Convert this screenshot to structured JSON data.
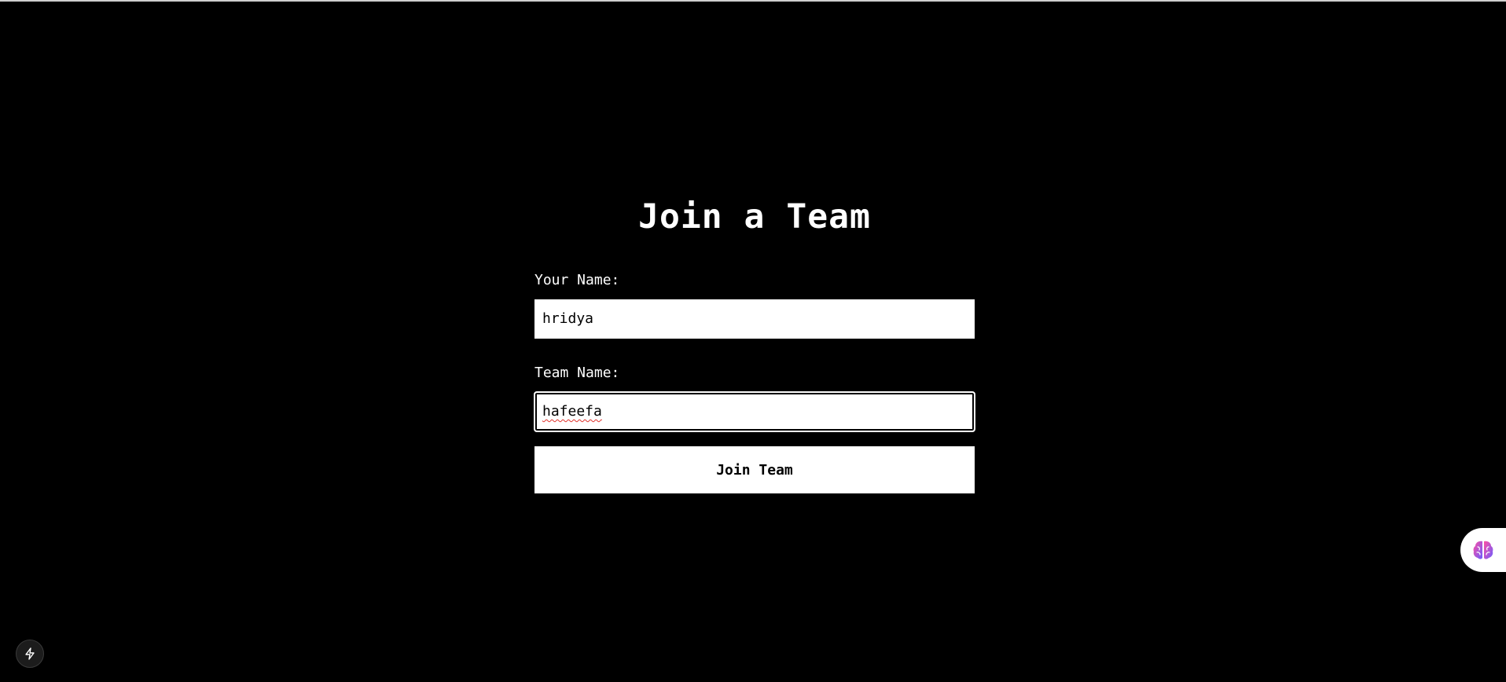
{
  "page": {
    "title": "Join a Team"
  },
  "form": {
    "name_label": "Your Name:",
    "name_value": "hridya",
    "team_label": "Team Name:",
    "team_value": "hafeefa",
    "submit_label": "Join Team"
  },
  "widgets": {
    "brain_icon": "brain-icon",
    "bolt_icon": "lightning-bolt-icon"
  },
  "colors": {
    "background": "#000000",
    "foreground": "#ffffff",
    "brain_gradient_start": "#ff4fa3",
    "brain_gradient_end": "#6c5cff"
  }
}
